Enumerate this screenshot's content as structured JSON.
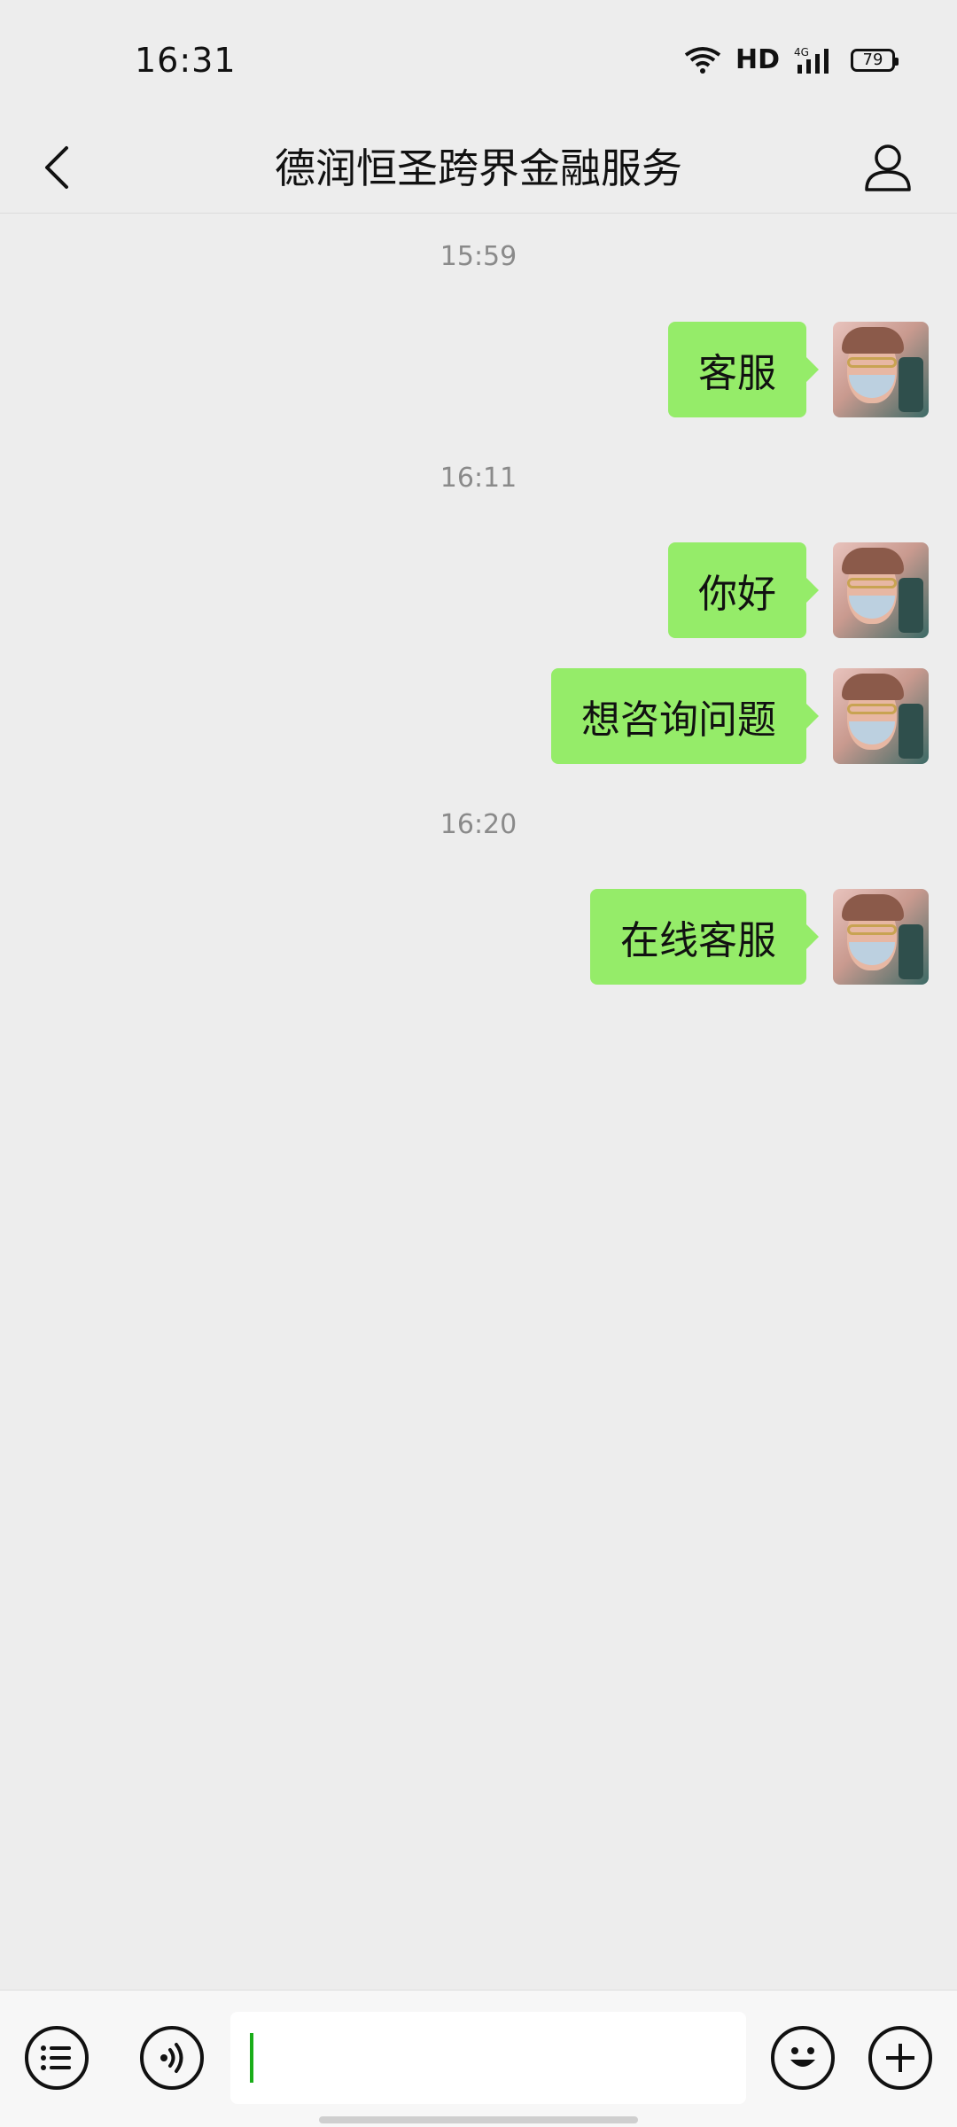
{
  "status_bar": {
    "time": "16:31",
    "network_label": "HD",
    "network_type": "4G",
    "battery": "79",
    "icons": [
      "wifi-icon",
      "signal-icon",
      "battery-icon"
    ]
  },
  "header": {
    "title": "德润恒圣跨界金融服务",
    "back_icon": "chevron-left-icon",
    "profile_icon": "person-icon"
  },
  "messages": [
    {
      "timestamp": "15:59",
      "text": "客服"
    },
    {
      "timestamp": "16:11",
      "text": "你好"
    },
    {
      "timestamp": "",
      "text": "想咨询问题"
    },
    {
      "timestamp": "16:20",
      "text": "在线客服"
    }
  ],
  "input_bar": {
    "value": "",
    "left_icons": [
      "menu-list-icon",
      "voice-icon"
    ],
    "right_icons": [
      "emoji-icon",
      "plus-icon"
    ]
  },
  "colors": {
    "background": "#ededed",
    "bubble": "#95ec69",
    "timestamp": "#8a8a8a",
    "caret": "#1aad19"
  }
}
